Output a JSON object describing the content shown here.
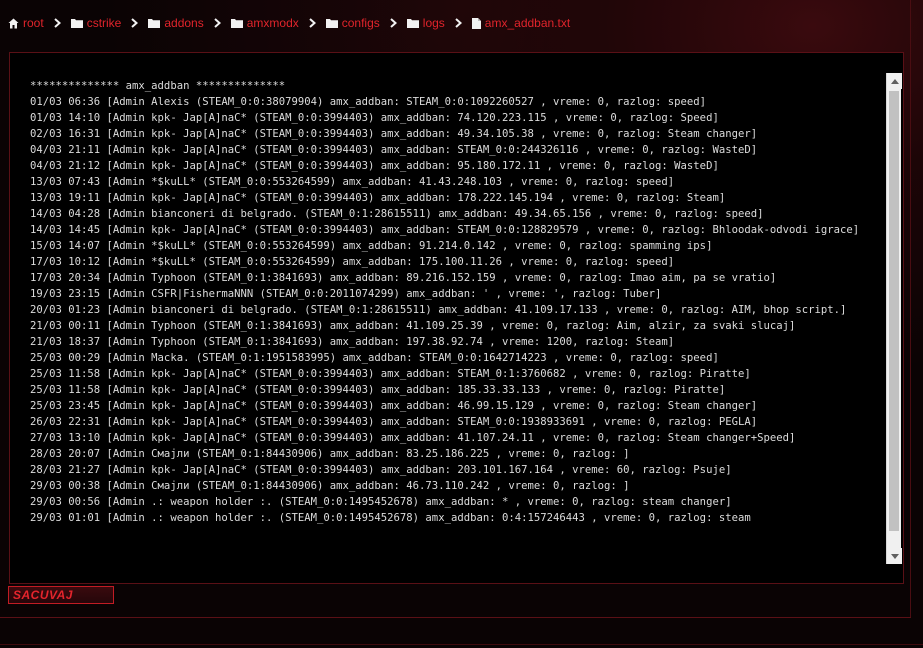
{
  "breadcrumb": [
    {
      "label": "root",
      "icon": "home-icon"
    },
    {
      "label": "cstrike",
      "icon": "folder-icon"
    },
    {
      "label": "addons",
      "icon": "folder-icon"
    },
    {
      "label": "amxmodx",
      "icon": "folder-icon"
    },
    {
      "label": "configs",
      "icon": "folder-icon"
    },
    {
      "label": "logs",
      "icon": "folder-icon"
    },
    {
      "label": "amx_addban.txt",
      "icon": "file-icon"
    }
  ],
  "editor": {
    "lines": [
      "************** amx_addban **************",
      "01/03 06:36 [Admin Alexis (STEAM_0:0:38079904) amx_addban: STEAM_0:0:1092260527 , vreme: 0, razlog: speed]",
      "01/03 14:10 [Admin kpk- Jap[A]naC* (STEAM_0:0:3994403) amx_addban: 74.120.223.115 , vreme: 0, razlog: Speed]",
      "02/03 16:31 [Admin kpk- Jap[A]naC* (STEAM_0:0:3994403) amx_addban: 49.34.105.38 , vreme: 0, razlog: Steam changer]",
      "04/03 21:11 [Admin kpk- Jap[A]naC* (STEAM_0:0:3994403) amx_addban: STEAM_0:0:244326116 , vreme: 0, razlog: WasteD]",
      "04/03 21:12 [Admin kpk- Jap[A]naC* (STEAM_0:0:3994403) amx_addban: 95.180.172.11 , vreme: 0, razlog: WasteD]",
      "13/03 07:43 [Admin *$kuLL* (STEAM_0:0:553264599) amx_addban: 41.43.248.103 , vreme: 0, razlog: speed]",
      "13/03 19:11 [Admin kpk- Jap[A]naC* (STEAM_0:0:3994403) amx_addban: 178.222.145.194 , vreme: 0, razlog: Steam]",
      "14/03 04:28 [Admin bianconeri di belgrado. (STEAM_0:1:28615511) amx_addban: 49.34.65.156 , vreme: 0, razlog: speed]",
      "14/03 14:45 [Admin kpk- Jap[A]naC* (STEAM_0:0:3994403) amx_addban: STEAM_0:0:128829579 , vreme: 0, razlog: Bhloodak-odvodi igrace]",
      "15/03 14:07 [Admin *$kuLL* (STEAM_0:0:553264599) amx_addban: 91.214.0.142 , vreme: 0, razlog: spamming ips]",
      "17/03 10:12 [Admin *$kuLL* (STEAM_0:0:553264599) amx_addban: 175.100.11.26 , vreme: 0, razlog: speed]",
      "17/03 20:34 [Admin Typhoon (STEAM_0:1:3841693) amx_addban: 89.216.152.159 , vreme: 0, razlog: Imao aim, pa se vratio]",
      "19/03 23:15 [Admin CSFR|FishermaNNN (STEAM_0:0:2011074299) amx_addban: ' , vreme: ', razlog: Tuber]",
      "20/03 01:23 [Admin bianconeri di belgrado. (STEAM_0:1:28615511) amx_addban: 41.109.17.133 , vreme: 0, razlog: AIM, bhop script.]",
      "21/03 00:11 [Admin Typhoon (STEAM_0:1:3841693) amx_addban: 41.109.25.39 , vreme: 0, razlog: Aim, alzir, za svaki slucaj]",
      "21/03 18:37 [Admin Typhoon (STEAM_0:1:3841693) amx_addban: 197.38.92.74 , vreme: 1200, razlog: Steam]",
      "25/03 00:29 [Admin Macka. (STEAM_0:1:1951583995) amx_addban: STEAM_0:0:1642714223 , vreme: 0, razlog: speed]",
      "25/03 11:58 [Admin kpk- Jap[A]naC* (STEAM_0:0:3994403) amx_addban: STEAM_0:1:3760682 , vreme: 0, razlog: Piratte]",
      "25/03 11:58 [Admin kpk- Jap[A]naC* (STEAM_0:0:3994403) amx_addban: 185.33.33.133 , vreme: 0, razlog: Piratte]",
      "25/03 23:45 [Admin kpk- Jap[A]naC* (STEAM_0:0:3994403) amx_addban: 46.99.15.129 , vreme: 0, razlog: Steam changer]",
      "26/03 22:31 [Admin kpk- Jap[A]naC* (STEAM_0:0:3994403) amx_addban: STEAM_0:0:1938933691 , vreme: 0, razlog: PEGLA]",
      "27/03 13:10 [Admin kpk- Jap[A]naC* (STEAM_0:0:3994403) amx_addban: 41.107.24.11 , vreme: 0, razlog: Steam changer+Speed]",
      "28/03 20:07 [Admin Смајли (STEAM_0:1:84430906) amx_addban: 83.25.186.225 , vreme: 0, razlog: ]",
      "28/03 21:27 [Admin kpk- Jap[A]naC* (STEAM_0:0:3994403) amx_addban: 203.101.167.164 , vreme: 60, razlog: Psuje]",
      "29/03 00:38 [Admin Смајли (STEAM_0:1:84430906) amx_addban: 46.73.110.242 , vreme: 0, razlog: ]",
      "29/03 00:56 [Admin .: weapon holder :. (STEAM_0:0:1495452678) amx_addban: * , vreme: 0, razlog: steam changer]",
      "29/03 01:01 [Admin .: weapon holder :. (STEAM_0:0:1495452678) amx_addban: 0:4:157246443 , vreme: 0, razlog: steam"
    ]
  },
  "save_button": {
    "label": "SACUVAJ"
  },
  "colors": {
    "accent": "#e0242b",
    "text": "#dcdcdc",
    "background": "#0a0304",
    "editor_bg": "#000000"
  }
}
